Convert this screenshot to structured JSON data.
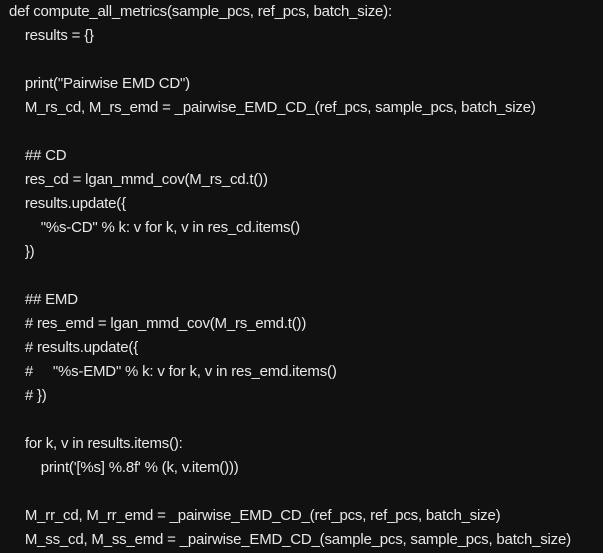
{
  "code": {
    "lines": [
      "def compute_all_metrics(sample_pcs, ref_pcs, batch_size):",
      "    results = {}",
      "",
      "    print(\"Pairwise EMD CD\")",
      "    M_rs_cd, M_rs_emd = _pairwise_EMD_CD_(ref_pcs, sample_pcs, batch_size)",
      "",
      "    ## CD",
      "    res_cd = lgan_mmd_cov(M_rs_cd.t())",
      "    results.update({",
      "        \"%s-CD\" % k: v for k, v in res_cd.items()",
      "    })",
      "",
      "    ## EMD",
      "    # res_emd = lgan_mmd_cov(M_rs_emd.t())",
      "    # results.update({",
      "    #     \"%s-EMD\" % k: v for k, v in res_emd.items()",
      "    # })",
      "",
      "    for k, v in results.items():",
      "        print('[%s] %.8f' % (k, v.item()))",
      "",
      "    M_rr_cd, M_rr_emd = _pairwise_EMD_CD_(ref_pcs, ref_pcs, batch_size)",
      "    M_ss_cd, M_ss_emd = _pairwise_EMD_CD_(sample_pcs, sample_pcs, batch_size)"
    ]
  }
}
